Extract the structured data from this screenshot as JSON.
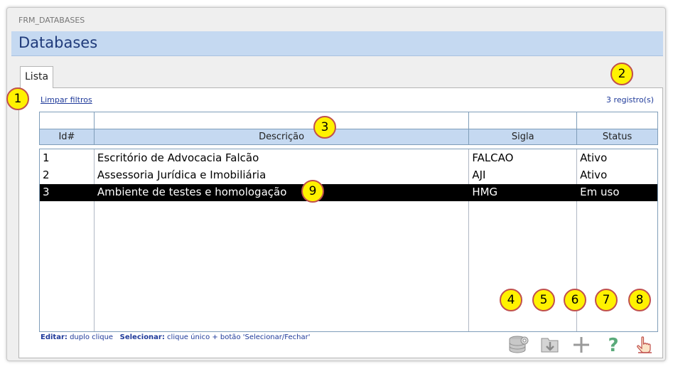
{
  "window": {
    "form_code": "FRM_DATABASES",
    "title": "Databases"
  },
  "tabs": [
    {
      "label": "Lista"
    }
  ],
  "list": {
    "clear_filters": "Limpar filtros",
    "record_count": "3 registro(s)",
    "columns": [
      "Id#",
      "Descrição",
      "Sigla",
      "Status"
    ],
    "rows": [
      {
        "id": "1",
        "descricao": "Escritório de Advocacia Falcão",
        "sigla": "FALCAO",
        "status": "Ativo"
      },
      {
        "id": "2",
        "descricao": "Assessoria Jurídica e Imobiliária",
        "sigla": "AJI",
        "status": "Ativo"
      },
      {
        "id": "3",
        "descricao": "Ambiente de testes e homologação",
        "sigla": "HMG",
        "status": "Em uso",
        "selected": true
      }
    ]
  },
  "help": {
    "edit_label": "Editar:",
    "edit_text": "duplo clique",
    "select_label": "Selecionar:",
    "select_text": "clique único + botão 'Selecionar/Fechar'"
  },
  "toolbar": [
    {
      "icon": "database-gear-icon"
    },
    {
      "icon": "folder-download-icon"
    },
    {
      "icon": "plus-icon"
    },
    {
      "icon": "question-mark-icon"
    },
    {
      "icon": "pointing-hand-icon"
    }
  ],
  "callouts": [
    "1",
    "2",
    "3",
    "4",
    "5",
    "6",
    "7",
    "8",
    "9"
  ],
  "colors": {
    "header_bg": "#c5d9f1",
    "title": "#1f3a7a",
    "link": "#1f3a9a",
    "callout_fill": "#fff200",
    "callout_border": "#c0504d"
  }
}
